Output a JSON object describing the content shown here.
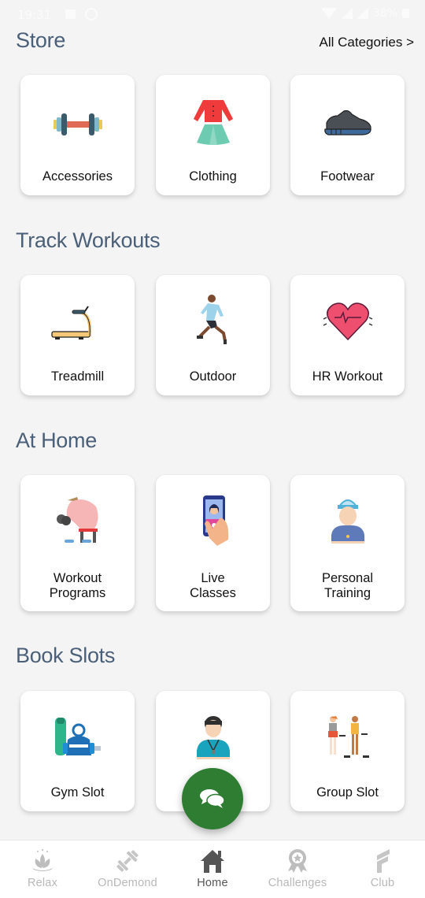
{
  "status_bar": {
    "time": "19:31",
    "battery": "38%"
  },
  "header": {
    "link_all_categories": "All Categories >"
  },
  "sections": [
    {
      "title": "Store",
      "cards": [
        {
          "label": "Accessories",
          "icon": "dumbbell-icon"
        },
        {
          "label": "Clothing",
          "icon": "clothing-icon"
        },
        {
          "label": "Footwear",
          "icon": "shoe-icon"
        }
      ]
    },
    {
      "title": "Track Workouts",
      "cards": [
        {
          "label": "Treadmill",
          "icon": "treadmill-icon"
        },
        {
          "label": "Outdoor",
          "icon": "runner-icon"
        },
        {
          "label": "HR Workout",
          "icon": "heart-rate-icon"
        }
      ]
    },
    {
      "title": "At Home",
      "cards": [
        {
          "label": "Workout\nPrograms",
          "icon": "bodybuilder-icon"
        },
        {
          "label": "Live\nClasses",
          "icon": "phone-video-icon"
        },
        {
          "label": "Personal\nTraining",
          "icon": "trainer-icon"
        }
      ]
    },
    {
      "title": "Book Slots",
      "cards": [
        {
          "label": "Gym Slot",
          "icon": "gym-gear-icon"
        },
        {
          "label": "",
          "icon": "coach-icon"
        },
        {
          "label": "Group Slot",
          "icon": "group-workout-icon"
        }
      ]
    }
  ],
  "fab": {
    "icon": "chat-icon"
  },
  "bottom_nav": [
    {
      "label": "Relax",
      "icon": "lotus-icon",
      "active": false
    },
    {
      "label": "OnDemond",
      "icon": "dumbbell-icon",
      "active": false
    },
    {
      "label": "Home",
      "icon": "home-icon",
      "active": true
    },
    {
      "label": "Challenges",
      "icon": "medal-icon",
      "active": false
    },
    {
      "label": "Club",
      "icon": "club-logo-icon",
      "active": false
    }
  ],
  "colors": {
    "background": "#f4f4f4",
    "section_title": "#4a5f78",
    "fab": "#2e7d32",
    "nav_active": "#555555",
    "nav_inactive": "#b8b8b8"
  }
}
